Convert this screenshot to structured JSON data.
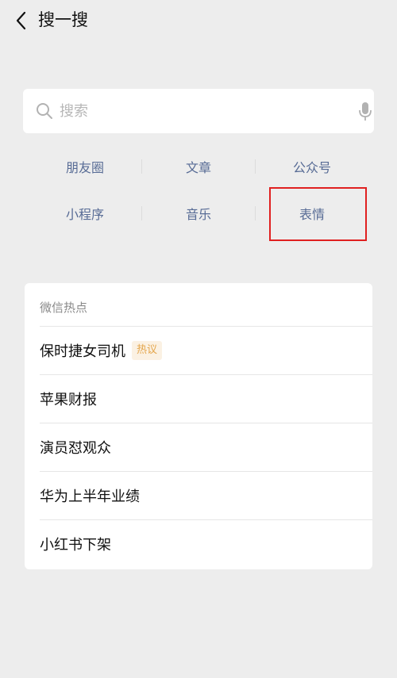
{
  "header": {
    "title": "搜一搜",
    "back_icon": "chevron-left-icon"
  },
  "search": {
    "placeholder": "搜索",
    "value": "",
    "search_icon": "search-icon",
    "voice_icon": "microphone-icon"
  },
  "categories": [
    {
      "label": "朋友圈"
    },
    {
      "label": "文章"
    },
    {
      "label": "公众号"
    },
    {
      "label": "小程序"
    },
    {
      "label": "音乐"
    },
    {
      "label": "表情"
    }
  ],
  "hot": {
    "header": "微信热点",
    "items": [
      {
        "title": "保时捷女司机",
        "badge": "热议"
      },
      {
        "title": "苹果财报"
      },
      {
        "title": "演员怼观众"
      },
      {
        "title": "华为上半年业绩"
      },
      {
        "title": "小红书下架"
      }
    ]
  },
  "colors": {
    "link": "#576b95",
    "background": "#ededed",
    "highlight_box": "#e02020",
    "badge_text": "#e4a54b"
  }
}
